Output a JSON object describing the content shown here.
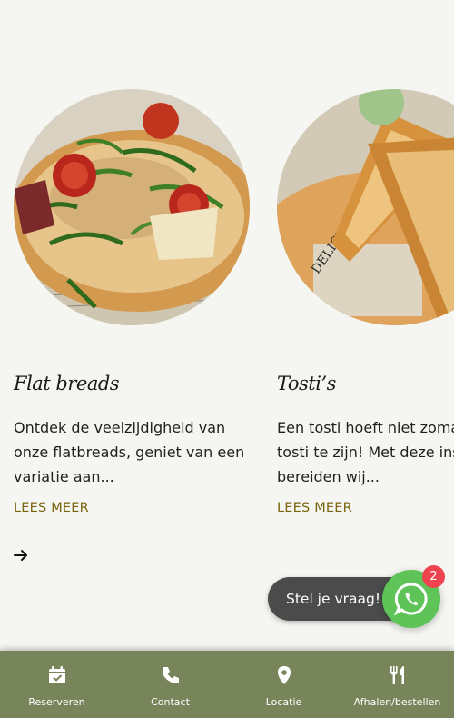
{
  "cards": [
    {
      "title": "Flat breads",
      "description": "Ontdek de veelzijdigheid van onze flatbreads, geniet van een variatie aan...",
      "read_more": "LEES MEER",
      "image_icon": "flatbread-photo"
    },
    {
      "title": "Tosti’s",
      "description_lines": [
        "Een tosti hoeft niet zomaa",
        "tosti te zijn! Met deze inste",
        "bereiden wij..."
      ],
      "read_more": "LEES MEER",
      "image_icon": "tosti-photo"
    }
  ],
  "carousel": {
    "next_icon": "arrow-right-icon"
  },
  "chat": {
    "bubble_text": "Stel je vraag!",
    "badge_count": "2",
    "icon": "whatsapp-icon"
  },
  "bottom_nav": {
    "items": [
      {
        "label": "Reserveren",
        "icon": "calendar-check-icon"
      },
      {
        "label": "Contact",
        "icon": "phone-icon"
      },
      {
        "label": "Locatie",
        "icon": "map-pin-icon"
      },
      {
        "label": "Afhalen/bestellen",
        "icon": "fork-knife-icon"
      }
    ]
  },
  "colors": {
    "background": "#f5f6f1",
    "nav_background": "#78845a",
    "link": "#7a6410",
    "whatsapp": "#5ec457",
    "badge": "#ef4450",
    "chat_bubble": "#4a4b4a"
  }
}
